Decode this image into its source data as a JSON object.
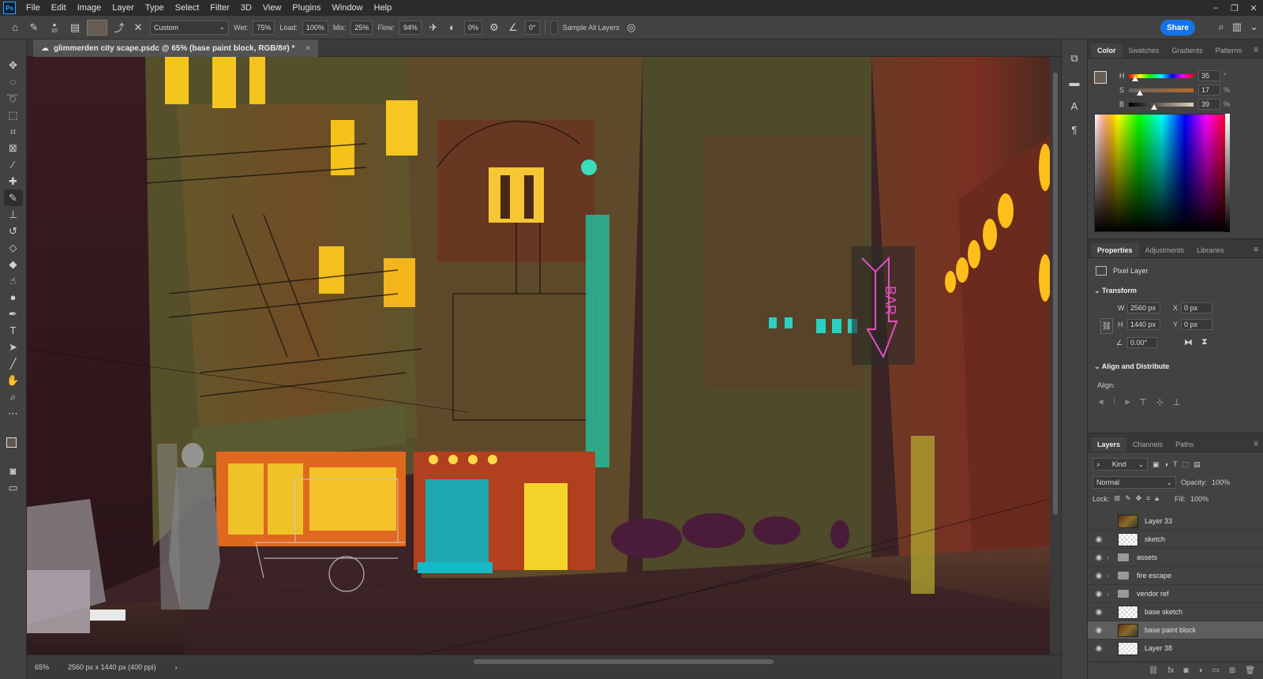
{
  "menubar": {
    "logo": "Ps",
    "items": [
      "File",
      "Edit",
      "Image",
      "Layer",
      "Type",
      "Select",
      "Filter",
      "3D",
      "View",
      "Plugins",
      "Window",
      "Help"
    ]
  },
  "options": {
    "brush_size": "20",
    "preset": "Custom",
    "wet_label": "Wet:",
    "wet_value": "75%",
    "load_label": "Load:",
    "load_value": "100%",
    "mix_label": "Mix:",
    "mix_value": "25%",
    "flow_label": "Flow:",
    "flow_value": "94%",
    "smoothing_value": "0%",
    "angle_value": "0°",
    "sample_all_layers": "Sample All Layers",
    "share": "Share",
    "swatch_color": "#675c52"
  },
  "document": {
    "tab_title": "glimmerden city scape.psdc @ 65% (base paint block, RGB/8#) *",
    "close_glyph": "×"
  },
  "statusbar": {
    "zoom": "65%",
    "doc_info": "2560 px x 1440 px (400 ppi)",
    "arrow": "›"
  },
  "tools": [
    "move-icon",
    "marquee-icon",
    "lasso-icon",
    "object-select-icon",
    "crop-icon",
    "frame-icon",
    "eyedropper-icon",
    "healing-icon",
    "mixer-brush-icon",
    "clone-stamp-icon",
    "history-brush-icon",
    "eraser-icon",
    "paint-bucket-icon",
    "smudge-icon",
    "dodge-icon",
    "pen-icon",
    "type-icon",
    "path-select-icon",
    "line-icon",
    "hand-icon",
    "zoom-icon",
    "more-tools-icon"
  ],
  "color_panel": {
    "tabs": [
      "Color",
      "Swatches",
      "Gradients",
      "Patterns"
    ],
    "h_label": "H",
    "h_value": "35",
    "h_unit": "°",
    "h_level": 0.1,
    "s_label": "S",
    "s_value": "17",
    "s_unit": "%",
    "s_level": 0.17,
    "b_label": "B",
    "b_value": "39",
    "b_unit": "%",
    "b_level": 0.39,
    "fg_color": "#675c52"
  },
  "properties": {
    "tabs": [
      "Properties",
      "Adjustments",
      "Libraries"
    ],
    "kind": "Pixel Layer",
    "transform_title": "Transform",
    "w_label": "W",
    "w_value": "2560 px",
    "h_label": "H",
    "h_value": "1440 px",
    "x_label": "X",
    "x_value": "0 px",
    "y_label": "Y",
    "y_value": "0 px",
    "angle_value": "0.00°",
    "align_title": "Align and Distribute",
    "align_label": "Align:"
  },
  "layers": {
    "tabs": [
      "Layers",
      "Channels",
      "Paths"
    ],
    "kind_filter": "Kind",
    "blend_mode": "Normal",
    "opacity_label": "Opacity:",
    "opacity_value": "100%",
    "lock_label": "Lock:",
    "fill_label": "Fill:",
    "fill_value": "100%",
    "items": [
      {
        "name": "Layer 33",
        "visible": false,
        "type": "image"
      },
      {
        "name": "sketch",
        "visible": true,
        "type": "pixel"
      },
      {
        "name": "assets",
        "visible": true,
        "type": "group"
      },
      {
        "name": "fire escape",
        "visible": true,
        "type": "group"
      },
      {
        "name": "vendor ref",
        "visible": true,
        "type": "group"
      },
      {
        "name": "base sketch",
        "visible": true,
        "type": "pixel"
      },
      {
        "name": "base paint block",
        "visible": true,
        "type": "image",
        "active": true
      },
      {
        "name": "Layer 38",
        "visible": true,
        "type": "pixel"
      }
    ]
  },
  "canvas": {
    "sign_text": "BAR"
  }
}
